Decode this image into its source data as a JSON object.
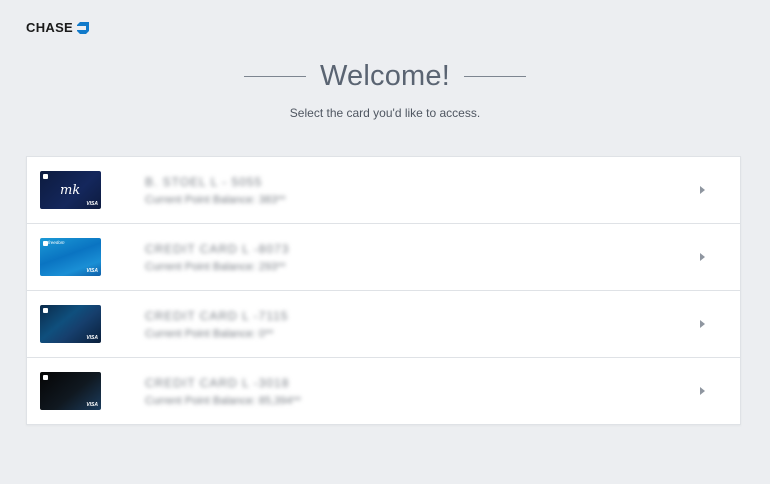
{
  "header": {
    "brand": "CHASE"
  },
  "welcome": {
    "title": "Welcome!",
    "subtitle": "Select the card you'd like to access."
  },
  "cards": [
    {
      "name": "B. STOEL L - 5055",
      "balance": "Current Point Balance: 383**",
      "style": "card-1"
    },
    {
      "name": "CREDIT CARD L -8073",
      "balance": "Current Point Balance: 293**",
      "style": "card-2"
    },
    {
      "name": "CREDIT CARD L -7115",
      "balance": "Current Point Balance: 0**",
      "style": "card-3"
    },
    {
      "name": "CREDIT CARD L -3018",
      "balance": "Current Point Balance: 85,394**",
      "style": "card-4"
    }
  ],
  "colors": {
    "background": "#eceef1",
    "title": "#5a6472",
    "brand_blue": "#117aca"
  },
  "icons": [
    "chase-octagon-icon",
    "chevron-right-icon"
  ]
}
